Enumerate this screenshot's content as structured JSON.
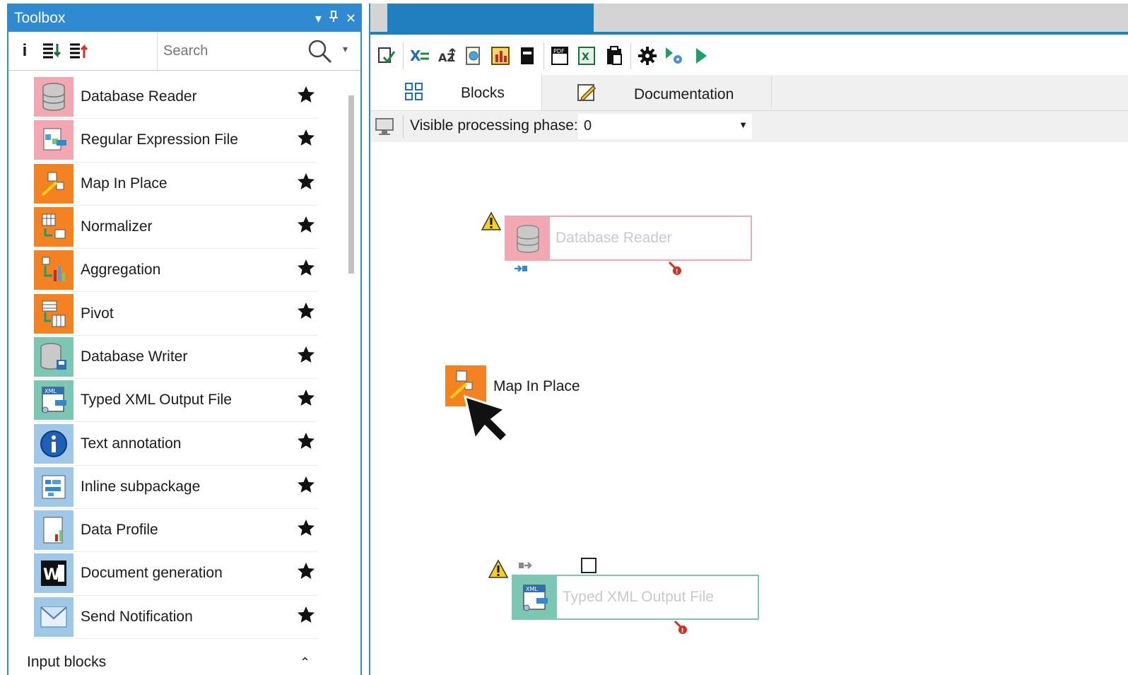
{
  "toolbox": {
    "title": "Toolbox",
    "controls": [
      "▾",
      "📌",
      "✕"
    ],
    "search": {
      "placeholder": "Search"
    },
    "items": [
      {
        "label": "Database Reader",
        "icon": "database-reader-icon",
        "color": "#f3a7b0"
      },
      {
        "label": "Regular Expression File",
        "icon": "regex-file-icon",
        "color": "#f3a7b0"
      },
      {
        "label": "Map In Place",
        "icon": "map-in-place-icon",
        "color": "#f58220"
      },
      {
        "label": "Normalizer",
        "icon": "normalizer-icon",
        "color": "#f58220"
      },
      {
        "label": "Aggregation",
        "icon": "aggregation-icon",
        "color": "#f58220"
      },
      {
        "label": "Pivot",
        "icon": "pivot-icon",
        "color": "#f58220"
      },
      {
        "label": "Database Writer",
        "icon": "database-writer-icon",
        "color": "#7cc6b4"
      },
      {
        "label": "Typed XML Output File",
        "icon": "xml-output-icon",
        "color": "#7cc6b4"
      },
      {
        "label": "Text annotation",
        "icon": "info-icon",
        "color": "#9fc7e8"
      },
      {
        "label": "Inline subpackage",
        "icon": "subpackage-icon",
        "color": "#9fc7e8"
      },
      {
        "label": "Data Profile",
        "icon": "data-profile-icon",
        "color": "#9fc7e8"
      },
      {
        "label": "Document generation",
        "icon": "word-doc-icon",
        "color": "#9fc7e8"
      },
      {
        "label": "Send Notification",
        "icon": "email-icon",
        "color": "#9fc7e8"
      }
    ],
    "section_label": "Input blocks"
  },
  "editor": {
    "tabs": {
      "blocks": "Blocks",
      "documentation": "Documentation"
    },
    "phase_label": "Visible processing phase:",
    "phase_value": "0",
    "canvas": {
      "db_reader": {
        "label": "Database Reader",
        "color": "#f3a7b0"
      },
      "map_in_place": {
        "label": "Map In Place",
        "color": "#f58220"
      },
      "xml_output": {
        "label": "Typed XML Output File",
        "color": "#7cc6b4"
      }
    }
  },
  "colors": {
    "accent": "#2f8ad2",
    "tab_active": "#1f7fbf"
  }
}
